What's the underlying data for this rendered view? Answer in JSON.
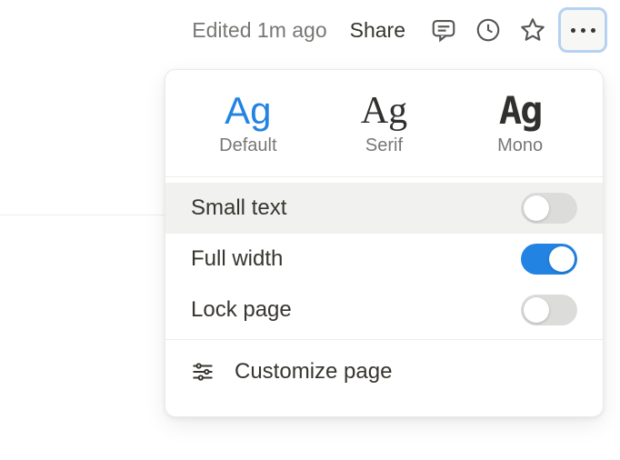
{
  "toolbar": {
    "edit_status": "Edited 1m ago",
    "share_label": "Share"
  },
  "menu": {
    "fonts": [
      {
        "sample": "Ag",
        "label": "Default",
        "selected": true,
        "class": ""
      },
      {
        "sample": "Ag",
        "label": "Serif",
        "selected": false,
        "class": "serif"
      },
      {
        "sample": "Ag",
        "label": "Mono",
        "selected": false,
        "class": "mono"
      }
    ],
    "toggles": {
      "small_text": {
        "label": "Small text",
        "on": false,
        "hover": true
      },
      "full_width": {
        "label": "Full width",
        "on": true,
        "hover": false
      },
      "lock_page": {
        "label": "Lock page",
        "on": false,
        "hover": false
      }
    },
    "customize_label": "Customize page"
  }
}
